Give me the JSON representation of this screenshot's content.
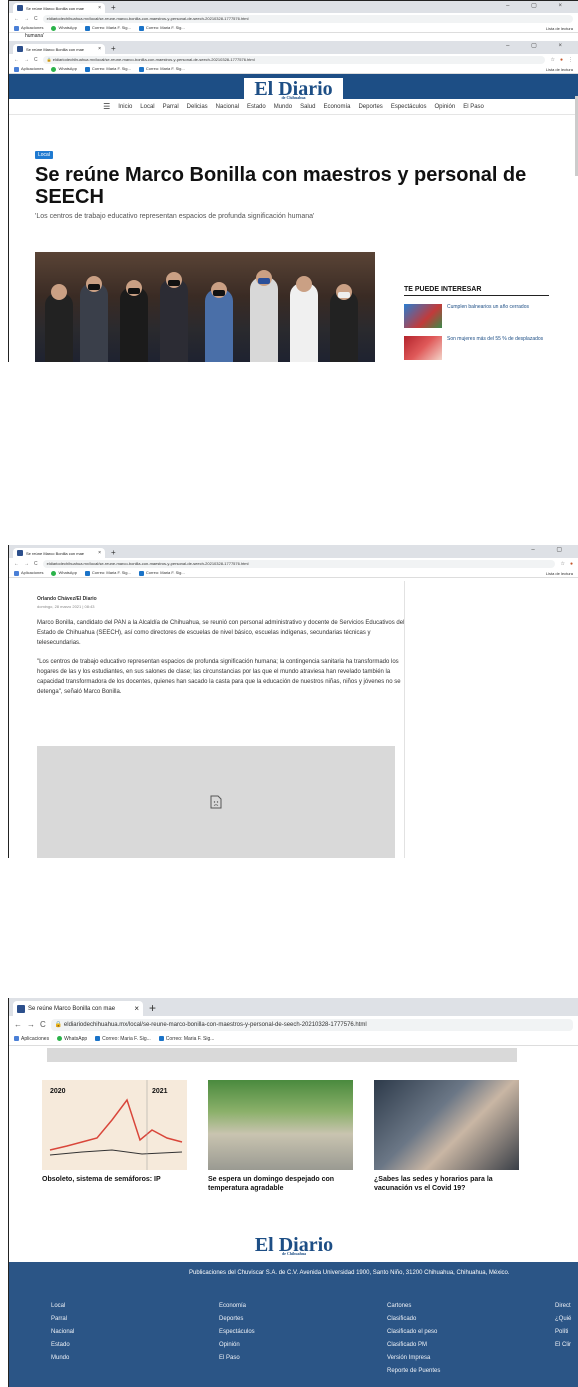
{
  "browser": {
    "tab_title": "Se reúne Marco Bonilla con mae",
    "url": "eldiariodechihuahua.mx/local/se-reune-marco-bonilla-con-maestros-y-personal-de-seech-20210328-1777576.html",
    "bookmarks": [
      "Aplicaciones",
      "WhatsApp",
      "Correo: Maria F. Sig...",
      "Correo: Maria F. Sig..."
    ],
    "reading_list": "Lista de lectura"
  },
  "site": {
    "logo": "El Diario",
    "logo_sub": "de Chihuahua",
    "nav": [
      "Inicio",
      "Local",
      "Parral",
      "Delicias",
      "Nacional",
      "Estado",
      "Mundo",
      "Salud",
      "Economía",
      "Deportes",
      "Espectáculos",
      "Opinión",
      "El Paso"
    ]
  },
  "article": {
    "section": "Local",
    "headline": "Se reúne Marco Bonilla con maestros y personal de SEECH",
    "subheadline": "'Los centros de trabajo educativo representan espacios de profunda significación humana'",
    "byline": "Orlando Chávez/El Diario",
    "date": "domingo, 28 marzo 2021 | 08:43",
    "paragraphs": [
      "Marco Bonilla, candidato del PAN a la Alcaldía de Chihuahua, se reunió con personal administrativo y docente de Servicios Educativos del Estado de Chihuahua (SEECH), así como directores de escuelas de nivel básico, escuelas indígenas, secundarias técnicas y telesecundarias.",
      "\"Los centros de trabajo educativo representan espacios de profunda significación humana; la contingencia sanitaria ha transformado los hogares de las y los estudiantes, en sus salones de clase; las circunstancias por las que el mundo atraviesa han revelado también la capacidad transformadora de los docentes, quienes han sacado la casta para que la educación de nuestros niñas, niños y jóvenes no se detenga\", señaló Marco Bonilla."
    ]
  },
  "sidebar": {
    "title": "TE PUEDE INTERESAR",
    "items": [
      "Cumplen balnearios un año cerrados",
      "Son mujeres más del 55 % de desplazados"
    ]
  },
  "related": [
    {
      "title": "Obsoleto, sistema de semáforos: IP",
      "chart_years": [
        "2020",
        "2021"
      ]
    },
    {
      "title": "Se espera un domingo despejado con temperatura agradable"
    },
    {
      "title": "¿Sabes las sedes y horarios para la vacunación vs el Covid 19?"
    }
  ],
  "footer": {
    "address": "Publicaciones del Chuviscar S.A. de C.V. Avenida Universidad 1900, Santo Niño, 31200 Chihuahua, Chihuahua, México.",
    "col1": [
      "Local",
      "Parral",
      "Nacional",
      "Estado",
      "Mundo"
    ],
    "col2": [
      "Economía",
      "Deportes",
      "Espectáculos",
      "Opinión",
      "El Paso"
    ],
    "col3": [
      "Cartones",
      "Clasificado",
      "Clasificado el peso",
      "Clasificado PM",
      "Versión Impresa",
      "Reporte de Puentes"
    ],
    "col4": [
      "Direct",
      "¿Quié",
      "Políti",
      "El Clir"
    ]
  },
  "colors": {
    "brand_blue": "#1d4e85",
    "badge": "#1f7ad1",
    "footer": "#2b5586"
  }
}
